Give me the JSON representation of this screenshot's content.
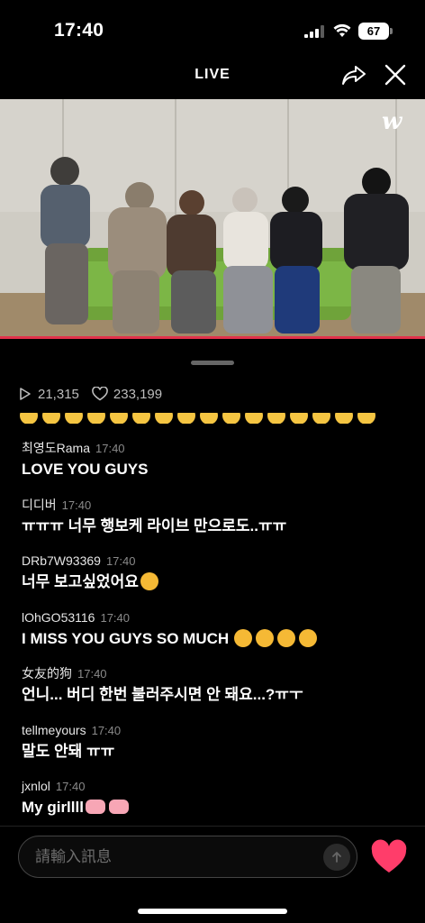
{
  "status": {
    "time": "17:40",
    "battery": "67"
  },
  "header": {
    "title": "LIVE"
  },
  "video": {
    "logo": "w",
    "progress_fraction": 1.0
  },
  "stats": {
    "plays": "21,315",
    "likes": "233,199"
  },
  "comments": [
    {
      "user": "최영도Rama",
      "time": "17:40",
      "text": "LOVE YOU GUYS"
    },
    {
      "user": "디디버",
      "time": "17:40",
      "text": "ㅠㅠㅠ 너무 행보케 라이브 만으로도..ㅠㅠ"
    },
    {
      "user": "DRb7W93369",
      "time": "17:40",
      "text": "너무 보고싶었어요",
      "emoji": "pleading-face"
    },
    {
      "user": "lOhGO53116",
      "time": "17:40",
      "text": "I MISS YOU GUYS SO MUCH",
      "emoji": "crying-cat-face x4"
    },
    {
      "user": "女友的狗",
      "time": "17:40",
      "text": "언니... 버디 한번 불러주시면 안 돼요...?ㅠㅜ"
    },
    {
      "user": "tellmeyours",
      "time": "17:40",
      "text": "말도 안돼 ㅠㅠ"
    },
    {
      "user": "jxnlol",
      "time": "17:40",
      "text": "My girllll",
      "emoji": "heart-hands x2"
    }
  ],
  "input": {
    "placeholder": "請輸入訊息"
  },
  "colors": {
    "accent": "#e2324b",
    "heart": "#ff3d6a"
  }
}
